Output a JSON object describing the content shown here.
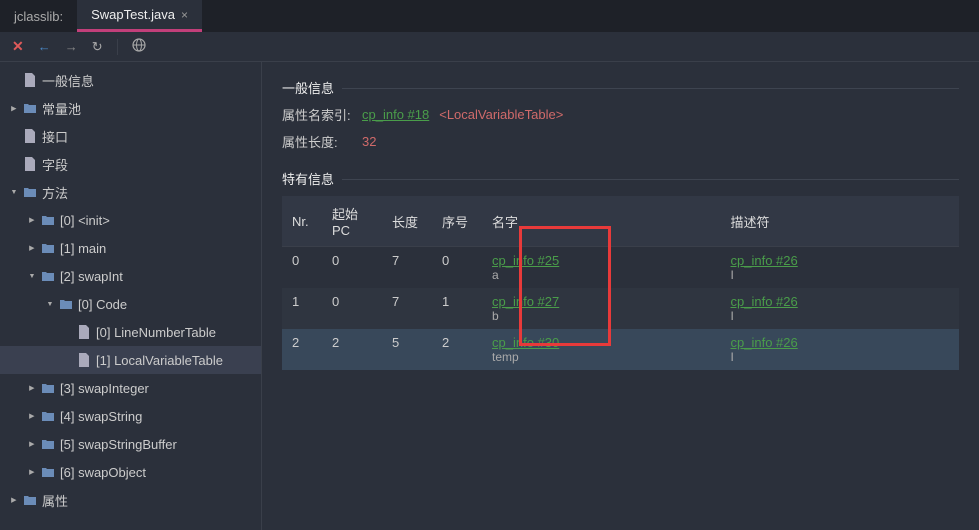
{
  "tabs": [
    {
      "label": "jclasslib:",
      "active": false
    },
    {
      "label": "SwapTest.java",
      "active": true
    }
  ],
  "sidebar": [
    {
      "label": "一般信息",
      "icon": "file",
      "depth": 0,
      "chev": ""
    },
    {
      "label": "常量池",
      "icon": "folder",
      "depth": 0,
      "chev": "right"
    },
    {
      "label": "接口",
      "icon": "file",
      "depth": 0,
      "chev": ""
    },
    {
      "label": "字段",
      "icon": "file",
      "depth": 0,
      "chev": ""
    },
    {
      "label": "方法",
      "icon": "folder",
      "depth": 0,
      "chev": "down"
    },
    {
      "label": "[0] <init>",
      "icon": "folder",
      "depth": 1,
      "chev": "right"
    },
    {
      "label": "[1] main",
      "icon": "folder",
      "depth": 1,
      "chev": "right"
    },
    {
      "label": "[2] swapInt",
      "icon": "folder",
      "depth": 1,
      "chev": "down"
    },
    {
      "label": "[0] Code",
      "icon": "folder",
      "depth": 2,
      "chev": "down"
    },
    {
      "label": "[0] LineNumberTable",
      "icon": "file",
      "depth": 3,
      "chev": ""
    },
    {
      "label": "[1] LocalVariableTable",
      "icon": "file",
      "depth": 3,
      "chev": "",
      "selected": true
    },
    {
      "label": "[3] swapInteger",
      "icon": "folder",
      "depth": 1,
      "chev": "right"
    },
    {
      "label": "[4] swapString",
      "icon": "folder",
      "depth": 1,
      "chev": "right"
    },
    {
      "label": "[5] swapStringBuffer",
      "icon": "folder",
      "depth": 1,
      "chev": "right"
    },
    {
      "label": "[6] swapObject",
      "icon": "folder",
      "depth": 1,
      "chev": "right"
    },
    {
      "label": "属性",
      "icon": "folder",
      "depth": 0,
      "chev": "right"
    }
  ],
  "general": {
    "title": "一般信息",
    "attrNameLabel": "属性名索引:",
    "attrNameLink": "cp_info #18",
    "attrNameTag": "<LocalVariableTable>",
    "attrLenLabel": "属性长度:",
    "attrLenVal": "32"
  },
  "specific": {
    "title": "特有信息",
    "headers": [
      "Nr.",
      "起始PC",
      "长度",
      "序号",
      "名字",
      "描述符"
    ],
    "rows": [
      {
        "nr": "0",
        "pc": "0",
        "len": "7",
        "idx": "0",
        "nameLink": "cp_info #25",
        "nameSub": "a",
        "descLink": "cp_info #26",
        "descSub": "I",
        "sel": false
      },
      {
        "nr": "1",
        "pc": "0",
        "len": "7",
        "idx": "1",
        "nameLink": "cp_info #27",
        "nameSub": "b",
        "descLink": "cp_info #26",
        "descSub": "I",
        "sel": false
      },
      {
        "nr": "2",
        "pc": "2",
        "len": "5",
        "idx": "2",
        "nameLink": "cp_info #30",
        "nameSub": "temp",
        "descLink": "cp_info #26",
        "descSub": "I",
        "sel": true
      }
    ]
  }
}
